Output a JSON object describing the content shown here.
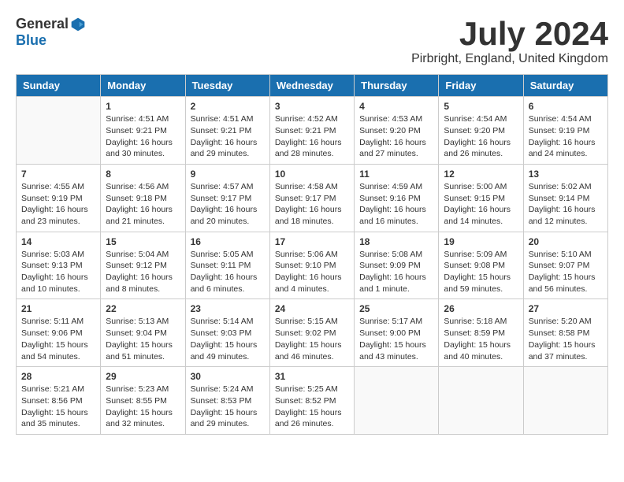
{
  "logo": {
    "general": "General",
    "blue": "Blue"
  },
  "title": {
    "month": "July 2024",
    "location": "Pirbright, England, United Kingdom"
  },
  "weekdays": [
    "Sunday",
    "Monday",
    "Tuesday",
    "Wednesday",
    "Thursday",
    "Friday",
    "Saturday"
  ],
  "weeks": [
    [
      {
        "day": "",
        "sunrise": "",
        "sunset": "",
        "daylight": ""
      },
      {
        "day": "1",
        "sunrise": "Sunrise: 4:51 AM",
        "sunset": "Sunset: 9:21 PM",
        "daylight": "Daylight: 16 hours and 30 minutes."
      },
      {
        "day": "2",
        "sunrise": "Sunrise: 4:51 AM",
        "sunset": "Sunset: 9:21 PM",
        "daylight": "Daylight: 16 hours and 29 minutes."
      },
      {
        "day": "3",
        "sunrise": "Sunrise: 4:52 AM",
        "sunset": "Sunset: 9:21 PM",
        "daylight": "Daylight: 16 hours and 28 minutes."
      },
      {
        "day": "4",
        "sunrise": "Sunrise: 4:53 AM",
        "sunset": "Sunset: 9:20 PM",
        "daylight": "Daylight: 16 hours and 27 minutes."
      },
      {
        "day": "5",
        "sunrise": "Sunrise: 4:54 AM",
        "sunset": "Sunset: 9:20 PM",
        "daylight": "Daylight: 16 hours and 26 minutes."
      },
      {
        "day": "6",
        "sunrise": "Sunrise: 4:54 AM",
        "sunset": "Sunset: 9:19 PM",
        "daylight": "Daylight: 16 hours and 24 minutes."
      }
    ],
    [
      {
        "day": "7",
        "sunrise": "Sunrise: 4:55 AM",
        "sunset": "Sunset: 9:19 PM",
        "daylight": "Daylight: 16 hours and 23 minutes."
      },
      {
        "day": "8",
        "sunrise": "Sunrise: 4:56 AM",
        "sunset": "Sunset: 9:18 PM",
        "daylight": "Daylight: 16 hours and 21 minutes."
      },
      {
        "day": "9",
        "sunrise": "Sunrise: 4:57 AM",
        "sunset": "Sunset: 9:17 PM",
        "daylight": "Daylight: 16 hours and 20 minutes."
      },
      {
        "day": "10",
        "sunrise": "Sunrise: 4:58 AM",
        "sunset": "Sunset: 9:17 PM",
        "daylight": "Daylight: 16 hours and 18 minutes."
      },
      {
        "day": "11",
        "sunrise": "Sunrise: 4:59 AM",
        "sunset": "Sunset: 9:16 PM",
        "daylight": "Daylight: 16 hours and 16 minutes."
      },
      {
        "day": "12",
        "sunrise": "Sunrise: 5:00 AM",
        "sunset": "Sunset: 9:15 PM",
        "daylight": "Daylight: 16 hours and 14 minutes."
      },
      {
        "day": "13",
        "sunrise": "Sunrise: 5:02 AM",
        "sunset": "Sunset: 9:14 PM",
        "daylight": "Daylight: 16 hours and 12 minutes."
      }
    ],
    [
      {
        "day": "14",
        "sunrise": "Sunrise: 5:03 AM",
        "sunset": "Sunset: 9:13 PM",
        "daylight": "Daylight: 16 hours and 10 minutes."
      },
      {
        "day": "15",
        "sunrise": "Sunrise: 5:04 AM",
        "sunset": "Sunset: 9:12 PM",
        "daylight": "Daylight: 16 hours and 8 minutes."
      },
      {
        "day": "16",
        "sunrise": "Sunrise: 5:05 AM",
        "sunset": "Sunset: 9:11 PM",
        "daylight": "Daylight: 16 hours and 6 minutes."
      },
      {
        "day": "17",
        "sunrise": "Sunrise: 5:06 AM",
        "sunset": "Sunset: 9:10 PM",
        "daylight": "Daylight: 16 hours and 4 minutes."
      },
      {
        "day": "18",
        "sunrise": "Sunrise: 5:08 AM",
        "sunset": "Sunset: 9:09 PM",
        "daylight": "Daylight: 16 hours and 1 minute."
      },
      {
        "day": "19",
        "sunrise": "Sunrise: 5:09 AM",
        "sunset": "Sunset: 9:08 PM",
        "daylight": "Daylight: 15 hours and 59 minutes."
      },
      {
        "day": "20",
        "sunrise": "Sunrise: 5:10 AM",
        "sunset": "Sunset: 9:07 PM",
        "daylight": "Daylight: 15 hours and 56 minutes."
      }
    ],
    [
      {
        "day": "21",
        "sunrise": "Sunrise: 5:11 AM",
        "sunset": "Sunset: 9:06 PM",
        "daylight": "Daylight: 15 hours and 54 minutes."
      },
      {
        "day": "22",
        "sunrise": "Sunrise: 5:13 AM",
        "sunset": "Sunset: 9:04 PM",
        "daylight": "Daylight: 15 hours and 51 minutes."
      },
      {
        "day": "23",
        "sunrise": "Sunrise: 5:14 AM",
        "sunset": "Sunset: 9:03 PM",
        "daylight": "Daylight: 15 hours and 49 minutes."
      },
      {
        "day": "24",
        "sunrise": "Sunrise: 5:15 AM",
        "sunset": "Sunset: 9:02 PM",
        "daylight": "Daylight: 15 hours and 46 minutes."
      },
      {
        "day": "25",
        "sunrise": "Sunrise: 5:17 AM",
        "sunset": "Sunset: 9:00 PM",
        "daylight": "Daylight: 15 hours and 43 minutes."
      },
      {
        "day": "26",
        "sunrise": "Sunrise: 5:18 AM",
        "sunset": "Sunset: 8:59 PM",
        "daylight": "Daylight: 15 hours and 40 minutes."
      },
      {
        "day": "27",
        "sunrise": "Sunrise: 5:20 AM",
        "sunset": "Sunset: 8:58 PM",
        "daylight": "Daylight: 15 hours and 37 minutes."
      }
    ],
    [
      {
        "day": "28",
        "sunrise": "Sunrise: 5:21 AM",
        "sunset": "Sunset: 8:56 PM",
        "daylight": "Daylight: 15 hours and 35 minutes."
      },
      {
        "day": "29",
        "sunrise": "Sunrise: 5:23 AM",
        "sunset": "Sunset: 8:55 PM",
        "daylight": "Daylight: 15 hours and 32 minutes."
      },
      {
        "day": "30",
        "sunrise": "Sunrise: 5:24 AM",
        "sunset": "Sunset: 8:53 PM",
        "daylight": "Daylight: 15 hours and 29 minutes."
      },
      {
        "day": "31",
        "sunrise": "Sunrise: 5:25 AM",
        "sunset": "Sunset: 8:52 PM",
        "daylight": "Daylight: 15 hours and 26 minutes."
      },
      {
        "day": "",
        "sunrise": "",
        "sunset": "",
        "daylight": ""
      },
      {
        "day": "",
        "sunrise": "",
        "sunset": "",
        "daylight": ""
      },
      {
        "day": "",
        "sunrise": "",
        "sunset": "",
        "daylight": ""
      }
    ]
  ]
}
